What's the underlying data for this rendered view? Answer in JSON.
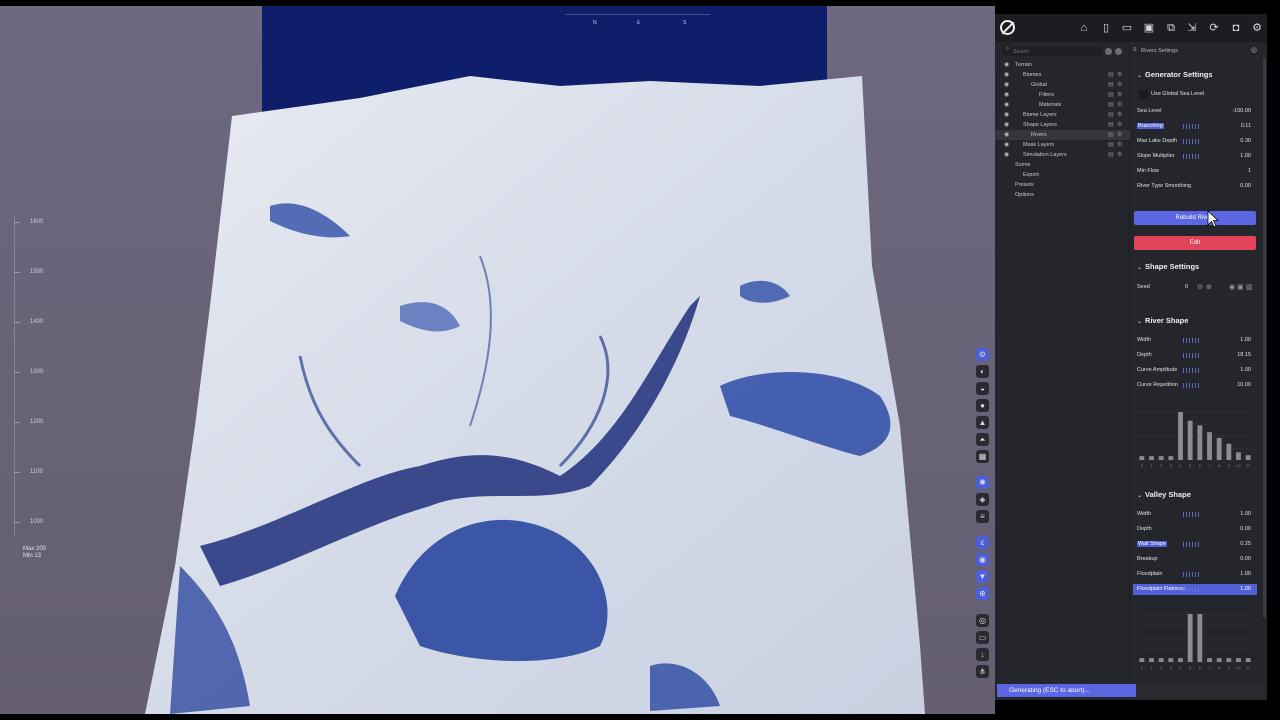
{
  "app": {
    "toolbar_icons": [
      "home-icon",
      "new-file-icon",
      "open-folder-icon",
      "save-icon",
      "save-as-icon",
      "export-icon",
      "refresh-icon",
      "screenshot-icon",
      "settings-icon"
    ]
  },
  "viewport": {
    "compass_labels": [
      "N",
      "E",
      "S"
    ],
    "height_ticks": [
      "1600",
      "1500",
      "1400",
      "1300",
      "1200",
      "1100",
      "1000"
    ],
    "max_label": "Max 200",
    "min_label": "Min 13",
    "tool_icons": [
      "select-tool-icon",
      "brush-icon",
      "stamp-icon",
      "drop-icon",
      "mountain-icon",
      "terrain-icon",
      "grid-icon",
      "sun-icon",
      "layers-icon",
      "menu-icon",
      "ec-icon",
      "visibility-icon",
      "filter-icon",
      "globe-icon",
      "target-icon",
      "folder-icon",
      "download-icon",
      "network-icon"
    ]
  },
  "tree": {
    "search_placeholder": "Search",
    "items": [
      {
        "label": "Terrain",
        "indent": 0
      },
      {
        "label": "Biomes",
        "indent": 1
      },
      {
        "label": "Global",
        "indent": 2
      },
      {
        "label": "Filters",
        "indent": 3
      },
      {
        "label": "Materials",
        "indent": 3
      },
      {
        "label": "Biome Layers",
        "indent": 1
      },
      {
        "label": "Shape Layers",
        "indent": 1
      },
      {
        "label": "Rivers",
        "indent": 2,
        "selected": true
      },
      {
        "label": "Mask Layers",
        "indent": 1
      },
      {
        "label": "Simulation Layers",
        "indent": 1
      },
      {
        "label": "Scene",
        "indent": 0
      },
      {
        "label": "Export",
        "indent": 1
      },
      {
        "label": "Presets",
        "indent": 0
      },
      {
        "label": "Options",
        "indent": 0
      }
    ]
  },
  "settings": {
    "header": "Rivers Settings",
    "generator": {
      "title": "Generator Settings",
      "use_global_sea_level": "Use Global Sea Level",
      "rows": [
        {
          "label": "Sea Level",
          "value": "-100.00"
        },
        {
          "label": "Branching",
          "value": "0.11"
        },
        {
          "label": "Max Lake Depth",
          "value": "0.30"
        },
        {
          "label": "Slope Multiplier",
          "value": "1.00"
        },
        {
          "label": "Min Flow",
          "value": "1"
        },
        {
          "label": "River Type Smoothing",
          "value": "0.00"
        }
      ],
      "rebuild_label": "Rebuild Rivers",
      "edit_label": "Edit"
    },
    "shape": {
      "title": "Shape Settings",
      "seed_label": "Seed",
      "seed_value": "0"
    },
    "river_shape": {
      "title": "River Shape",
      "rows": [
        {
          "label": "Width",
          "value": "1.00"
        },
        {
          "label": "Depth",
          "value": "18.15"
        },
        {
          "label": "Curve Amplitude",
          "value": "1.00"
        },
        {
          "label": "Curve Repetition",
          "value": "10.00"
        }
      ],
      "histogram": [
        0.08,
        0.08,
        0.08,
        0.08,
        1.0,
        0.82,
        0.72,
        0.58,
        0.46,
        0.34,
        0.16,
        0.1
      ]
    },
    "valley_shape": {
      "title": "Valley Shape",
      "rows": [
        {
          "label": "Width",
          "value": "1.00"
        },
        {
          "label": "Depth",
          "value": "0.00"
        },
        {
          "label": "Wall Shape",
          "value": "0.25"
        },
        {
          "label": "Breakup",
          "value": "0.00"
        },
        {
          "label": "Floodplain",
          "value": "1.00"
        },
        {
          "label": "Floodplain Flatness",
          "value": "1.00"
        }
      ],
      "histogram": [
        0.08,
        0.08,
        0.08,
        0.08,
        0.08,
        1.0,
        1.0,
        0.08,
        0.08,
        0.08,
        0.08,
        0.08
      ]
    }
  },
  "status": {
    "text": "Generating (ESC to abort)...",
    "progress": 0.52
  }
}
